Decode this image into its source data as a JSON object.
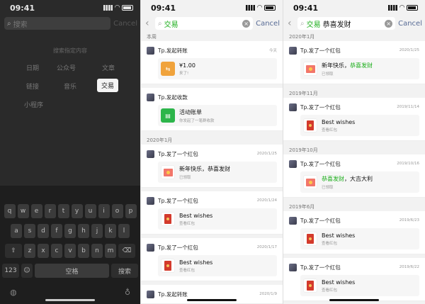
{
  "status_time": "09:41",
  "panel1": {
    "search_placeholder": "搜索",
    "cancel": "Cancel",
    "hint": "搜索指定内容",
    "categories": [
      "日期",
      "公众号",
      "文章",
      "链接",
      "音乐",
      "交易",
      "小程序"
    ],
    "keyboard": {
      "row1": [
        "q",
        "w",
        "e",
        "r",
        "t",
        "y",
        "u",
        "i",
        "o",
        "p"
      ],
      "row2": [
        "a",
        "s",
        "d",
        "f",
        "g",
        "h",
        "j",
        "k",
        "l"
      ],
      "row3": [
        "z",
        "x",
        "c",
        "v",
        "b",
        "n",
        "m"
      ],
      "num": "123",
      "space": "空格",
      "search": "搜索"
    }
  },
  "panel2": {
    "search_tag": "交易",
    "cancel": "Cancel",
    "sections": [
      {
        "header": "本周",
        "items": [
          {
            "name": "Tp.发起转账",
            "date": "今天",
            "title": "¥1.00",
            "sub": "来了!",
            "icon": "transfer-icon"
          },
          {
            "name": "Tp.发起收款",
            "date": "",
            "title": "活动账单",
            "sub": "你发起了一笔群收款",
            "icon": "collect-icon"
          }
        ]
      },
      {
        "header": "2020年1月",
        "items": [
          {
            "name": "Tp.发了一个红包",
            "date": "2020/1/25",
            "title": "新年快乐，恭喜发财",
            "sub": "已领取",
            "icon": "envelope-icon"
          },
          {
            "name": "Tp.发了一个红包",
            "date": "2020/1/24",
            "title": "Best wishes",
            "sub": "查看红包",
            "icon": "red-packet-icon"
          },
          {
            "name": "Tp.发了一个红包",
            "date": "2020/1/17",
            "title": "Best wishes",
            "sub": "查看红包",
            "icon": "red-packet-icon"
          },
          {
            "name": "Tp.发起转账",
            "date": "2020/1/9",
            "title": "",
            "sub": "",
            "icon": "transfer-icon"
          }
        ]
      }
    ]
  },
  "panel3": {
    "search_tag": "交易",
    "search_text": "恭喜发财",
    "cancel": "Cancel",
    "sections": [
      {
        "header": "2020年1月",
        "items": [
          {
            "name": "Tp.发了一个红包",
            "date": "2020/1/25",
            "title_hl": "新年快乐，",
            "title_g": "恭喜发财",
            "sub": "已领取",
            "icon": "envelope-icon"
          }
        ]
      },
      {
        "header": "2019年11月",
        "items": [
          {
            "name": "Tp.发了一个红包",
            "date": "2019/11/14",
            "title": "Best wishes",
            "sub": "查看红包",
            "icon": "red-packet-icon"
          }
        ]
      },
      {
        "header": "2019年10月",
        "items": [
          {
            "name": "Tp.发了一个红包",
            "date": "2019/10/16",
            "title_g": "恭喜发财",
            "title_hl": "，大吉大利",
            "sub": "已领取",
            "icon": "envelope-icon"
          }
        ]
      },
      {
        "header": "2019年6月",
        "items": [
          {
            "name": "Tp.发了一个红包",
            "date": "2019/6/23",
            "title": "Best wishes",
            "sub": "查看红包",
            "icon": "red-packet-icon"
          },
          {
            "name": "Tp.发了一个红包",
            "date": "2019/6/22",
            "title": "Best wishes",
            "sub": "查看红包",
            "icon": "red-packet-icon"
          }
        ]
      }
    ]
  }
}
